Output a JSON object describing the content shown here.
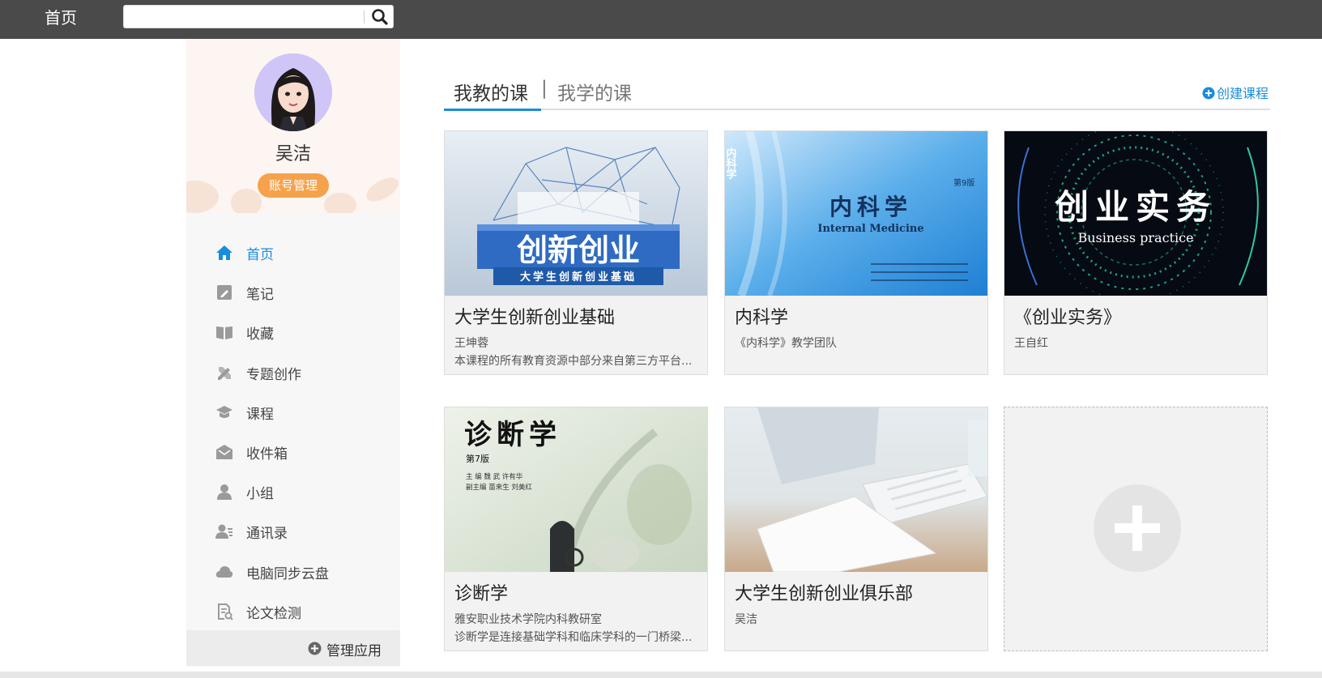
{
  "topbar": {
    "home_label": "首页",
    "search_placeholder": ""
  },
  "profile": {
    "name": "吴洁",
    "account_button": "账号管理"
  },
  "nav": [
    {
      "label": "首页",
      "icon": "home-icon",
      "active": true
    },
    {
      "label": "笔记",
      "icon": "note-icon"
    },
    {
      "label": "收藏",
      "icon": "book-icon"
    },
    {
      "label": "专题创作",
      "icon": "tools-icon"
    },
    {
      "label": "课程",
      "icon": "graduation-cap-icon"
    },
    {
      "label": "收件箱",
      "icon": "mail-icon"
    },
    {
      "label": "小组",
      "icon": "user-icon"
    },
    {
      "label": "通讯录",
      "icon": "contacts-icon"
    },
    {
      "label": "电脑同步云盘",
      "icon": "cloud-icon"
    },
    {
      "label": "论文检测",
      "icon": "document-check-icon"
    }
  ],
  "manage_apps": "管理应用",
  "tabs": {
    "teaching": "我教的课",
    "separator": "|",
    "learning": "我学的课"
  },
  "create_course": "创建课程",
  "courses": [
    {
      "title": "大学生创新创业基础",
      "teacher": "王坤蓉",
      "desc": "本课程的所有教育资源中部分来自第三方平台...",
      "cover_text": "创新创业",
      "cover_sub": "大学生创新创业基础"
    },
    {
      "title": "内科学",
      "teacher": "《内科学》教学团队",
      "desc": "",
      "cover_text": "内科学",
      "cover_sub": "Internal Medicine",
      "cover_badge": "第9版",
      "cover_side": "内科学"
    },
    {
      "title": "《创业实务》",
      "teacher": "王自红",
      "desc": "",
      "cover_text": "创业实务",
      "cover_sub": "Business practice"
    },
    {
      "title": "诊断学",
      "teacher": "雅安职业技术学院内科教研室",
      "desc": "诊断学是连接基础学科和临床学科的一门桥梁...",
      "cover_text": "诊断学",
      "cover_edition": "第7版",
      "cover_line1": "主 编  魏 武  许有华",
      "cover_line2": "副主编  苗来生  刘美红"
    },
    {
      "title": "大学生创新创业俱乐部",
      "teacher": "吴洁",
      "desc": ""
    }
  ],
  "colors": {
    "accent": "#1a8cdc",
    "topbar": "#4a4a4a",
    "account_button": "#f5a24b"
  }
}
